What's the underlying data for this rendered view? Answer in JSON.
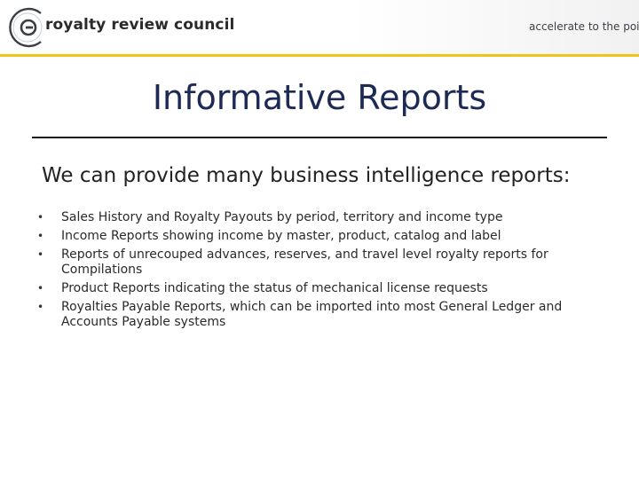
{
  "header": {
    "brand": "royalty review council",
    "tagline": "accelerate to the point",
    "logo_icon": "circle-c-logo-icon",
    "accent_color": "#f0c419"
  },
  "slide": {
    "title": "Informative Reports",
    "intro": "We can provide many business intelligence reports:",
    "bullets": [
      "Sales History and Royalty Payouts by period, territory and income type",
      "Income Reports showing income by master, product, catalog and label",
      "Reports of unrecouped advances, reserves, and travel level royalty reports for Compilations",
      "Product Reports indicating the status of mechanical license requests",
      "Royalties Payable Reports, which can be imported into most General Ledger and Accounts Payable systems"
    ]
  }
}
